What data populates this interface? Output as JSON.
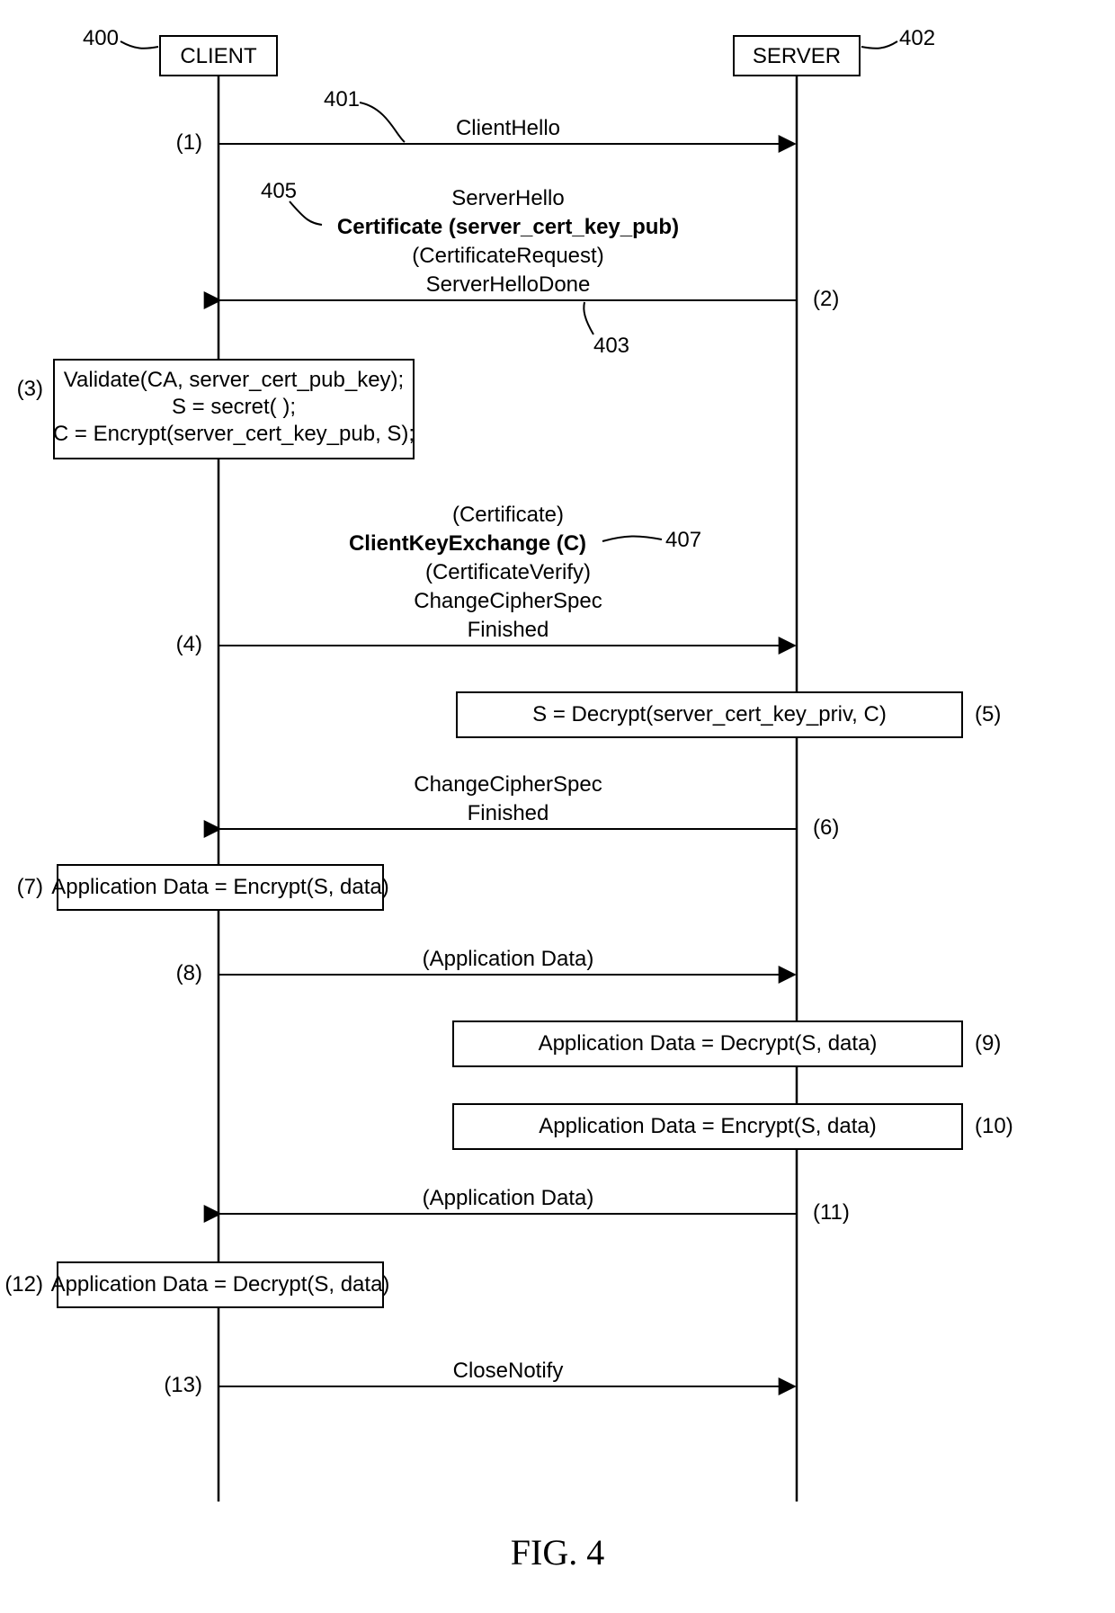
{
  "figure_label": "FIG. 4",
  "lifelines": {
    "client": {
      "title": "CLIENT",
      "ref": "400"
    },
    "server": {
      "title": "SERVER",
      "ref": "402"
    }
  },
  "callouts": {
    "client_hello": "401",
    "serverhello_done": "403",
    "certificate_pub": "405",
    "client_key_exchange": "407"
  },
  "steps": {
    "s1": "(1)",
    "s2": "(2)",
    "s3": "(3)",
    "s4": "(4)",
    "s5": "(5)",
    "s6": "(6)",
    "s7": "(7)",
    "s8": "(8)",
    "s9": "(9)",
    "s10": "(10)",
    "s11": "(11)",
    "s12": "(12)",
    "s13": "(13)"
  },
  "messages": {
    "client_hello": "ClientHello",
    "server_hello": "ServerHello",
    "certificate_pub": "Certificate (server_cert_key_pub)",
    "certificate_request": "(CertificateRequest)",
    "server_hello_done": "ServerHelloDone",
    "certificate": "(Certificate)",
    "client_key_exchange": "ClientKeyExchange (C)",
    "certificate_verify": "(CertificateVerify)",
    "change_cipher_spec": "ChangeCipherSpec",
    "finished": "Finished",
    "app_data": "(Application Data)",
    "close_notify": "CloseNotify"
  },
  "boxes": {
    "b3_l1": "Validate(CA, server_cert_pub_key);",
    "b3_l2": "S = secret( );",
    "b3_l3": "C = Encrypt(server_cert_key_pub, S);",
    "b5": "S = Decrypt(server_cert_key_priv, C)",
    "b7": "Application Data = Encrypt(S, data)",
    "b9": "Application Data = Decrypt(S, data)",
    "b10": "Application Data = Encrypt(S, data)",
    "b12": "Application Data = Decrypt(S, data)"
  }
}
